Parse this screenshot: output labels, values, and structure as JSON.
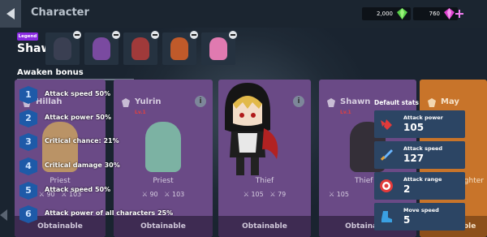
{
  "header": {
    "title": "Character",
    "gold": "2,000",
    "gems": "760"
  },
  "character": {
    "badge": "Legend",
    "name": "Shawn"
  },
  "awaken": {
    "title": "Awaken bonus",
    "items": [
      {
        "num": "1",
        "text": "Attack speed 50%"
      },
      {
        "num": "2",
        "text": "Attack power 50%"
      },
      {
        "num": "3",
        "text": "Critical chance: 21%"
      },
      {
        "num": "4",
        "text": "Critical damage 30%"
      },
      {
        "num": "5",
        "text": "Attack speed 50%"
      },
      {
        "num": "6",
        "text": "Attack power of all characters 25%"
      }
    ]
  },
  "cards": [
    {
      "name": "Hillah",
      "lv": "",
      "role": "Priest",
      "atk": "90",
      "spd": "103",
      "status": "Obtainable"
    },
    {
      "name": "Yulrin",
      "lv": "Lv.1",
      "role": "Priest",
      "atk": "90",
      "spd": "103",
      "status": "Obtainable"
    },
    {
      "name": "",
      "lv": "",
      "role": "Thief",
      "atk": "105",
      "spd": "79",
      "status": "Obtainable"
    },
    {
      "name": "Shawn",
      "lv": "Lv.1",
      "role": "Thief",
      "atk": "105",
      "spd": "",
      "status": "Obtainable"
    },
    {
      "name": "May",
      "lv": "",
      "role": "Fighter",
      "atk": "",
      "spd": "",
      "status": "Obtainable"
    }
  ],
  "default_stats": {
    "title": "Default stats",
    "items": [
      {
        "label": "Attack power",
        "value": "105"
      },
      {
        "label": "Attack speed",
        "value": "127"
      },
      {
        "label": "Attack range",
        "value": "2"
      },
      {
        "label": "Move speed",
        "value": "5"
      }
    ]
  },
  "info_glyph": "i",
  "colors": {
    "accent": "#8a2be2",
    "card_purple": "#6a4a86",
    "stat_blue": "#2c4564",
    "gold": "#f0a020"
  }
}
